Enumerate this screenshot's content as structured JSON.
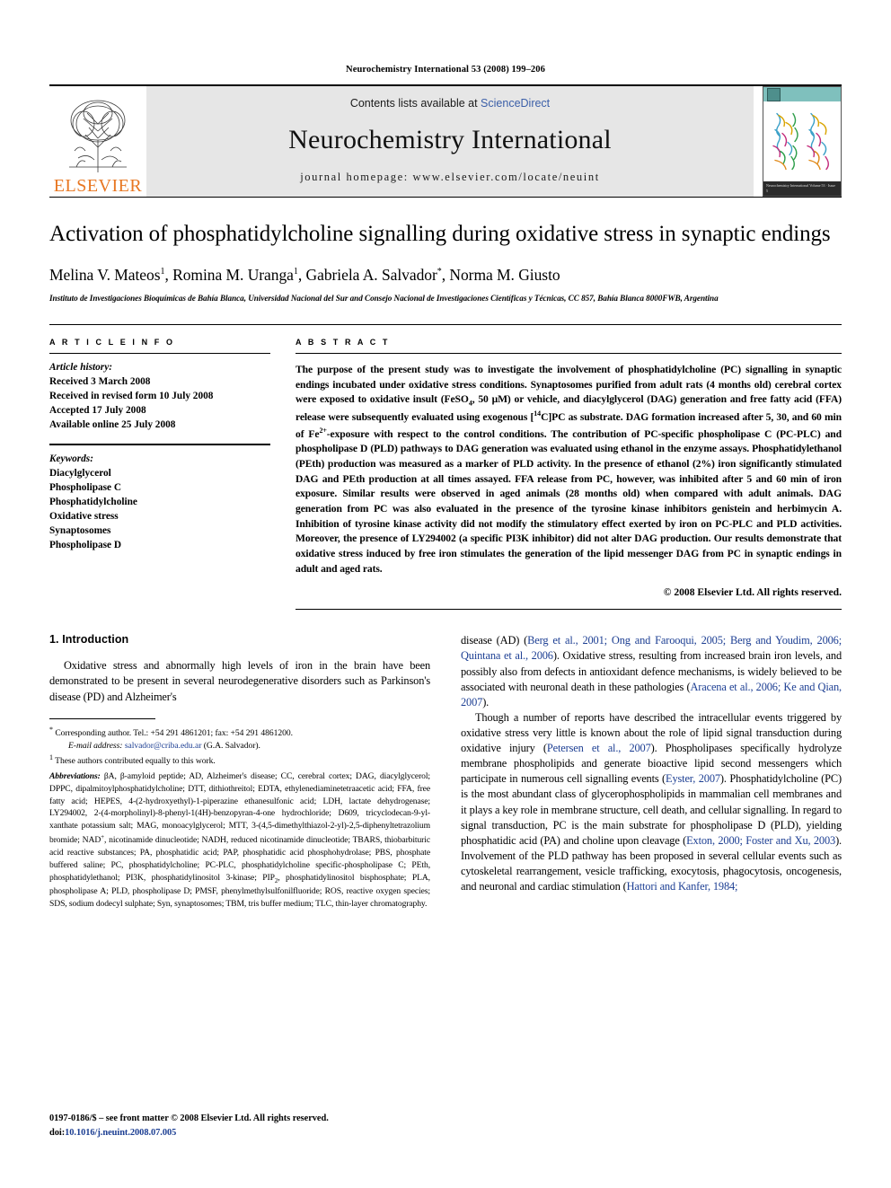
{
  "running_head": "Neurochemistry International 53 (2008) 199–206",
  "masthead": {
    "contents_prefix": "Contents lists available at ",
    "sciencedirect": "ScienceDirect",
    "journal_title": "Neurochemistry International",
    "homepage": "journal homepage: www.elsevier.com/locate/neuint",
    "publisher": "ELSEVIER",
    "publisher_logo_icon": "elsevier-tree-logo",
    "cover_caption": "Neurochemistry International\nVolume 53 · Issue 5",
    "accent_orange": "#E87722",
    "link_blue": "#3b5fa8",
    "band_gray": "#e6e6e6",
    "cover_teal": "#7fc0bd"
  },
  "article": {
    "title": "Activation of phosphatidylcholine signalling during oxidative stress in synaptic endings",
    "authors_html": "Melina V. Mateos, Romina M. Uranga, Gabriela A. Salvador, Norma M. Giusto",
    "authors_parts": [
      {
        "name": "Melina V. Mateos",
        "mark": "1",
        "sep": ", "
      },
      {
        "name": "Romina M. Uranga",
        "mark": "1",
        "sep": ", "
      },
      {
        "name": "Gabriela A. Salvador",
        "mark": "*",
        "sep": ", "
      },
      {
        "name": "Norma M. Giusto",
        "mark": "",
        "sep": ""
      }
    ],
    "affiliation": "Instituto de Investigaciones Bioquímicas de Bahía Blanca, Universidad Nacional del Sur and Consejo Nacional de Investigaciones Científicas y Técnicas, CC 857, Bahía Blanca 8000FWB, Argentina"
  },
  "article_info": {
    "heading": "A R T I C L E   I N F O",
    "history_label": "Article history:",
    "history": [
      "Received 3 March 2008",
      "Received in revised form 10 July 2008",
      "Accepted 17 July 2008",
      "Available online 25 July 2008"
    ],
    "keywords_label": "Keywords:",
    "keywords": [
      "Diacylglycerol",
      "Phospholipase C",
      "Phosphatidylcholine",
      "Oxidative stress",
      "Synaptosomes",
      "Phospholipase D"
    ]
  },
  "abstract": {
    "heading": "A B S T R A C T",
    "paragraph_segments": [
      "The purpose of the present study was to investigate the involvement of phosphatidylcholine (PC) signalling in synaptic endings incubated under oxidative stress conditions. Synaptosomes purified from adult rats (4 months old) cerebral cortex were exposed to oxidative insult (FeSO",
      "4",
      ", 50 μM) or vehicle, and diacylglycerol (DAG) generation and free fatty acid (FFA) release were subsequently evaluated using exogenous [",
      "14",
      "C]PC as substrate. DAG formation increased after 5, 30, and 60 min of Fe",
      "2+",
      "-exposure with respect to the control conditions. The contribution of PC-specific phospholipase C (PC-PLC) and phospholipase D (PLD) pathways to DAG generation was evaluated using ethanol in the enzyme assays. Phosphatidylethanol (PEth) production was measured as a marker of PLD activity. In the presence of ethanol (2%) iron significantly stimulated DAG and PEth production at all times assayed. FFA release from PC, however, was inhibited after 5 and 60 min of iron exposure. Similar results were observed in aged animals (28 months old) when compared with adult animals. DAG generation from PC was also evaluated in the presence of the tyrosine kinase inhibitors genistein and herbimycin A. Inhibition of tyrosine kinase activity did not modify the stimulatory effect exerted by iron on PC-PLC and PLD activities. Moreover, the presence of LY294002 (a specific PI3K inhibitor) did not alter DAG production. Our results demonstrate that oxidative stress induced by free iron stimulates the generation of the lipid messenger DAG from PC in synaptic endings in adult and aged rats."
    ],
    "copyright": "© 2008 Elsevier Ltd. All rights reserved."
  },
  "introduction": {
    "heading": "1. Introduction",
    "left_paragraph_1": "Oxidative stress and abnormally high levels of iron in the brain have been demonstrated to be present in several neurodegenerative disorders such as Parkinson's disease (PD) and Alzheimer's",
    "right_p1_pre": "disease (AD) (",
    "right_p1_cite1": "Berg et al., 2001; Ong and Farooqui, 2005; Berg and Youdim, 2006; Quintana et al., 2006",
    "right_p1_mid": "). Oxidative stress, resulting from increased brain iron levels, and possibly also from defects in antioxidant defence mechanisms, is widely believed to be associated with neuronal death in these pathologies (",
    "right_p1_cite2": "Aracena et al., 2006; Ke and Qian, 2007",
    "right_p1_end": ").",
    "right_p2_pre": "Though a number of reports have described the intracellular events triggered by oxidative stress very little is known about the role of lipid signal transduction during oxidative injury (",
    "right_p2_cite1": "Petersen et al., 2007",
    "right_p2_mid1": "). Phospholipases specifically hydrolyze membrane phospholipids and generate bioactive lipid second messengers which participate in numerous cell signalling events (",
    "right_p2_cite2": "Eyster, 2007",
    "right_p2_mid2": "). Phosphatidylcholine (PC) is the most abundant class of glycerophospholipids in mammalian cell membranes and it plays a key role in membrane structure, cell death, and cellular signalling. In regard to signal transduction, PC is the main substrate for phospholipase D (PLD), yielding phosphatidic acid (PA) and choline upon cleavage (",
    "right_p2_cite3": "Exton, 2000; Foster and Xu, 2003",
    "right_p2_mid3": "). Involvement of the PLD pathway has been proposed in several cellular events such as cytoskeletal rearrangement, vesicle trafficking, exocytosis, phagocytosis, oncogenesis, and neuronal and cardiac stimulation (",
    "right_p2_cite4": "Hattori and Kanfer, 1984;",
    "cite_color": "#1d3f93"
  },
  "footnotes": {
    "corresponding_mark": "*",
    "corresponding": "Corresponding author. Tel.: +54 291 4861201; fax: +54 291 4861200.",
    "email_label": "E-mail address:",
    "email": "salvador@criba.edu.ar",
    "email_suffix": "(G.A. Salvador).",
    "equal_mark": "1",
    "equal_contrib": "These authors contributed equally to this work.",
    "abbrev_label": "Abbreviations:",
    "abbrev_text": " βA, β-amyloid peptide; AD, Alzheimer's disease; CC, cerebral cortex; DAG, diacylglycerol; DPPC, dipalmitoylphosphatidylcholine; DTT, dithiothreitol; EDTA, ethylenediaminetetraacetic acid; FFA, free fatty acid; HEPES, 4-(2-hydroxyethyl)-1-piperazine ethanesulfonic acid; LDH, lactate dehydrogenase; LY294002, 2-(4-morpholinyl)-8-phenyl-1(4H)-benzopyran-4-one hydrochloride; D609, tricyclodecan-9-yl-xanthate potassium salt; MAG, monoacylglycerol; MTT, 3-(4,5-dimethylthiazol-2-yl)-2,5-diphenyltetrazolium bromide; NAD",
    "abbrev_sup1": "+",
    "abbrev_text2": ", nicotinamide dinucleotide; NADH, reduced nicotinamide dinucleotide; TBARS, thiobarbituric acid reactive substances; PA, phosphatidic acid; PAP, phosphatidic acid phosphohydrolase; PBS, phosphate buffered saline; PC, phosphatidylcholine; PC-PLC, phosphatidylcholine specific-phospholipase C; PEth, phosphatidylethanol; PI3K, phosphatidylinositol 3-kinase; PIP",
    "abbrev_sub1": "2",
    "abbrev_text3": ", phosphatidylinositol bisphosphate; PLA, phospholipase A; PLD, phospholipase D; PMSF, phenylmethylsulfonilfluoride; ROS, reactive oxygen species; SDS, sodium dodecyl sulphate; Syn, synaptosomes; TBM, tris buffer medium; TLC, thin-layer chromatography."
  },
  "page_footer": {
    "front_matter": "0197-0186/$ – see front matter © 2008 Elsevier Ltd. All rights reserved.",
    "doi_label": "doi:",
    "doi": "10.1016/j.neuint.2008.07.005"
  }
}
